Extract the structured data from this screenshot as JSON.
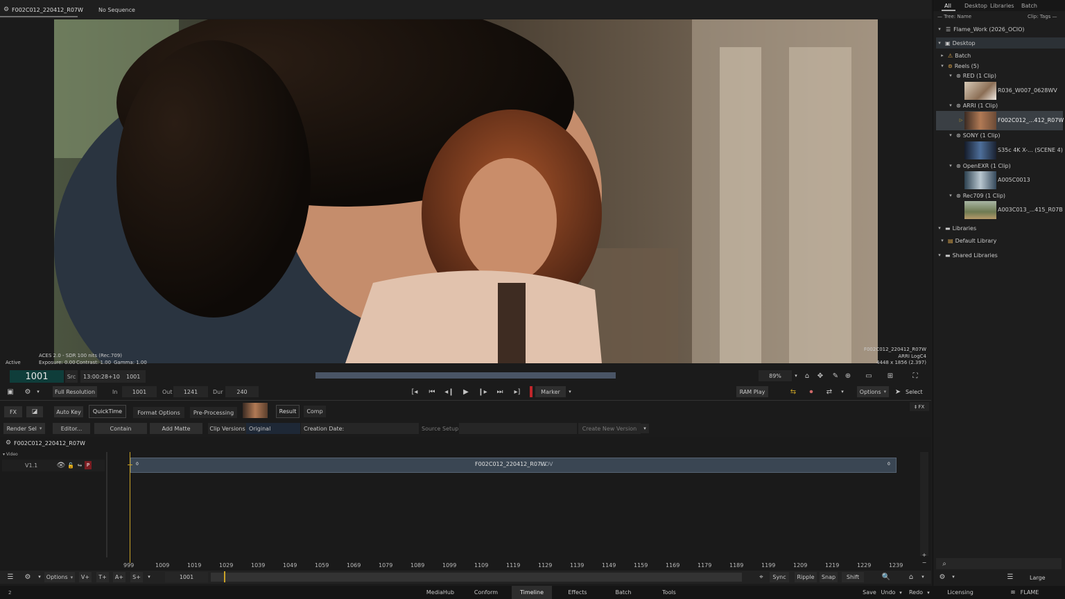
{
  "viewer": {
    "clip_name": "F002C012_220412_R07W",
    "sequence": "No Sequence",
    "overlay_left": {
      "status": "Active",
      "colour_space": "ACES 2.0 - SDR 100 nits (Rec.709)",
      "exposure": "Exposure: 0.00",
      "contrast": "Contrast: 1.00",
      "gamma": "Gamma: 1.00"
    },
    "overlay_right": {
      "clip": "F002C012_220412_R07W",
      "log": "ARRI LogC4",
      "resolution": "4448 x 1856 (2.397)"
    }
  },
  "transport": {
    "frame": "1001",
    "src_label": "Src",
    "timecode": "13:00:28+10",
    "src_frame": "1001",
    "zoom": "89%",
    "resolution_btn": "Full Resolution",
    "in_label": "In",
    "in_value": "1001",
    "out_label": "Out",
    "out_value": "1241",
    "dur_label": "Dur",
    "dur_value": "240",
    "marker": "Marker",
    "ram_play": "RAM Play",
    "options": "Options",
    "select": "Select"
  },
  "editor_tabs": {
    "fx": "FX",
    "auto_key": "Auto Key",
    "quicktime": "QuickTime",
    "format_options": "Format Options",
    "pre_processing": "Pre-Processing",
    "result": "Result",
    "comp": "Comp",
    "fx_toggle": "‡ FX"
  },
  "editor_row2": {
    "render_sel": "Render Sel",
    "editor": "Editor...",
    "contain": "Contain",
    "add_matte": "Add Matte",
    "clip_versions": "Clip Versions",
    "original": "Original",
    "creation_date": "Creation Date:",
    "source_setup": "Source Setup",
    "create_new_version": "Create New Version"
  },
  "timeline": {
    "sequence_name": "F002C012_220412_R07W",
    "video_label": "Video",
    "track": "V1.1",
    "clip_label": "F002C012_220412_R07W",
    "clip_format": "MOV",
    "clip_start_digit": "0",
    "clip_end_digit": "0",
    "ticks": [
      "999",
      "1009",
      "1019",
      "1029",
      "1039",
      "1049",
      "1059",
      "1069",
      "1079",
      "1089",
      "1099",
      "1109",
      "1119",
      "1129",
      "1139",
      "1149",
      "1159",
      "1169",
      "1179",
      "1189",
      "1199",
      "1209",
      "1219",
      "1229",
      "1239"
    ],
    "current_frame": "1001",
    "options": "Options",
    "v_plus": "V+",
    "t_plus": "T+",
    "a_plus": "A+",
    "s_plus": "S+",
    "sync": "Sync",
    "ripple": "Ripple",
    "snap": "Snap",
    "shift": "Shift"
  },
  "media_panel": {
    "tabs": [
      "All",
      "Desktop",
      "Libraries",
      "Batch"
    ],
    "tree_name": "— Tree: Name",
    "clip_tags": "Clip: Tags —",
    "project": "Flame_Work (2026_OCIO)",
    "desktop": "Desktop",
    "batch": "Batch",
    "reels": "Reels (5)",
    "groups": [
      {
        "name": "RED (1 Clip)",
        "clip": "R036_W007_0628WV"
      },
      {
        "name": "ARRI (1 Clip)",
        "clip": "F002C012_...412_R07W"
      },
      {
        "name": "SONY (1 Clip)",
        "clip": "S35c 4K X-... (SCENE 4)"
      },
      {
        "name": "OpenEXR (1 Clip)",
        "clip": "A005C0013"
      },
      {
        "name": "Rec709 (1 Clip)",
        "clip": "A003C013_...415_R07B"
      }
    ],
    "libraries": "Libraries",
    "default_library": "Default Library",
    "shared_libraries": "Shared Libraries",
    "size": "Large"
  },
  "bottom_tabs": [
    "MediaHub",
    "Conform",
    "Timeline",
    "Effects",
    "Batch",
    "Tools"
  ],
  "bottom_right": {
    "save": "Save",
    "undo": "Undo",
    "redo": "Redo",
    "licensing": "Licensing",
    "app": "FLAME"
  },
  "status_corner": "2",
  "colors": {
    "accent_yellow": "#c9a227",
    "frame_teal": "#0f3d3a",
    "selected_row": "#3a3f44"
  }
}
